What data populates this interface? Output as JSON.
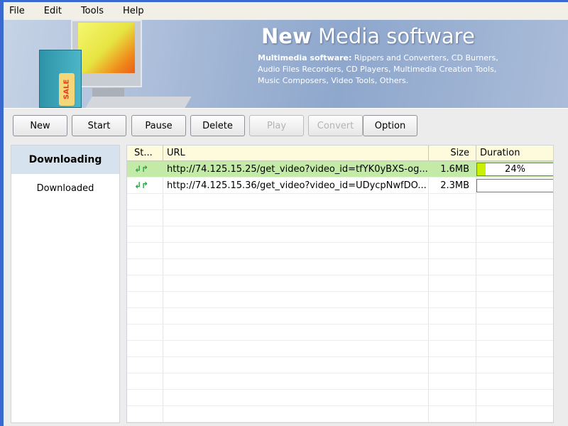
{
  "menu": [
    "File",
    "Edit",
    "Tools",
    "Help"
  ],
  "banner": {
    "title_bold": "New",
    "title_rest": " Media software",
    "desc_bold": "Multimedia software:",
    "desc": " Rippers and Converters, CD Burners, Audio Files Recorders, CD Players,  Multimedia Creation Tools, Music Composers, Video Tools, Others.",
    "tag": "SALE"
  },
  "toolbar": [
    {
      "label": "New",
      "enabled": true
    },
    {
      "label": "Start",
      "enabled": true
    },
    {
      "label": "Pause",
      "enabled": true
    },
    {
      "label": "Delete",
      "enabled": true
    },
    {
      "label": "Play",
      "enabled": false
    },
    {
      "label": "Convert",
      "enabled": false
    },
    {
      "label": "Option",
      "enabled": true
    }
  ],
  "sidebar": {
    "items": [
      {
        "label": "Downloading",
        "active": true
      },
      {
        "label": "Downloaded",
        "active": false
      }
    ]
  },
  "table": {
    "columns": [
      "St...",
      "URL",
      "Size",
      "Duration"
    ],
    "rows": [
      {
        "status_icon": "downloading-arrows-icon",
        "url": "http://74.125.15.25/get_video?video_id=tfYK0yBXS-og...",
        "size": "1.6MB",
        "progress": 24,
        "progress_label": "24%",
        "selected": true
      },
      {
        "status_icon": "downloading-arrows-icon",
        "url": "http://74.125.15.36/get_video?video_id=UDycpNwfDO...",
        "size": "2.3MB",
        "progress": 0,
        "progress_label": "",
        "selected": false
      }
    ]
  },
  "colors": {
    "selected_row": "#c4eaa8",
    "progress_fill": "#c8f000",
    "header_bg": "#fdfbdc"
  }
}
